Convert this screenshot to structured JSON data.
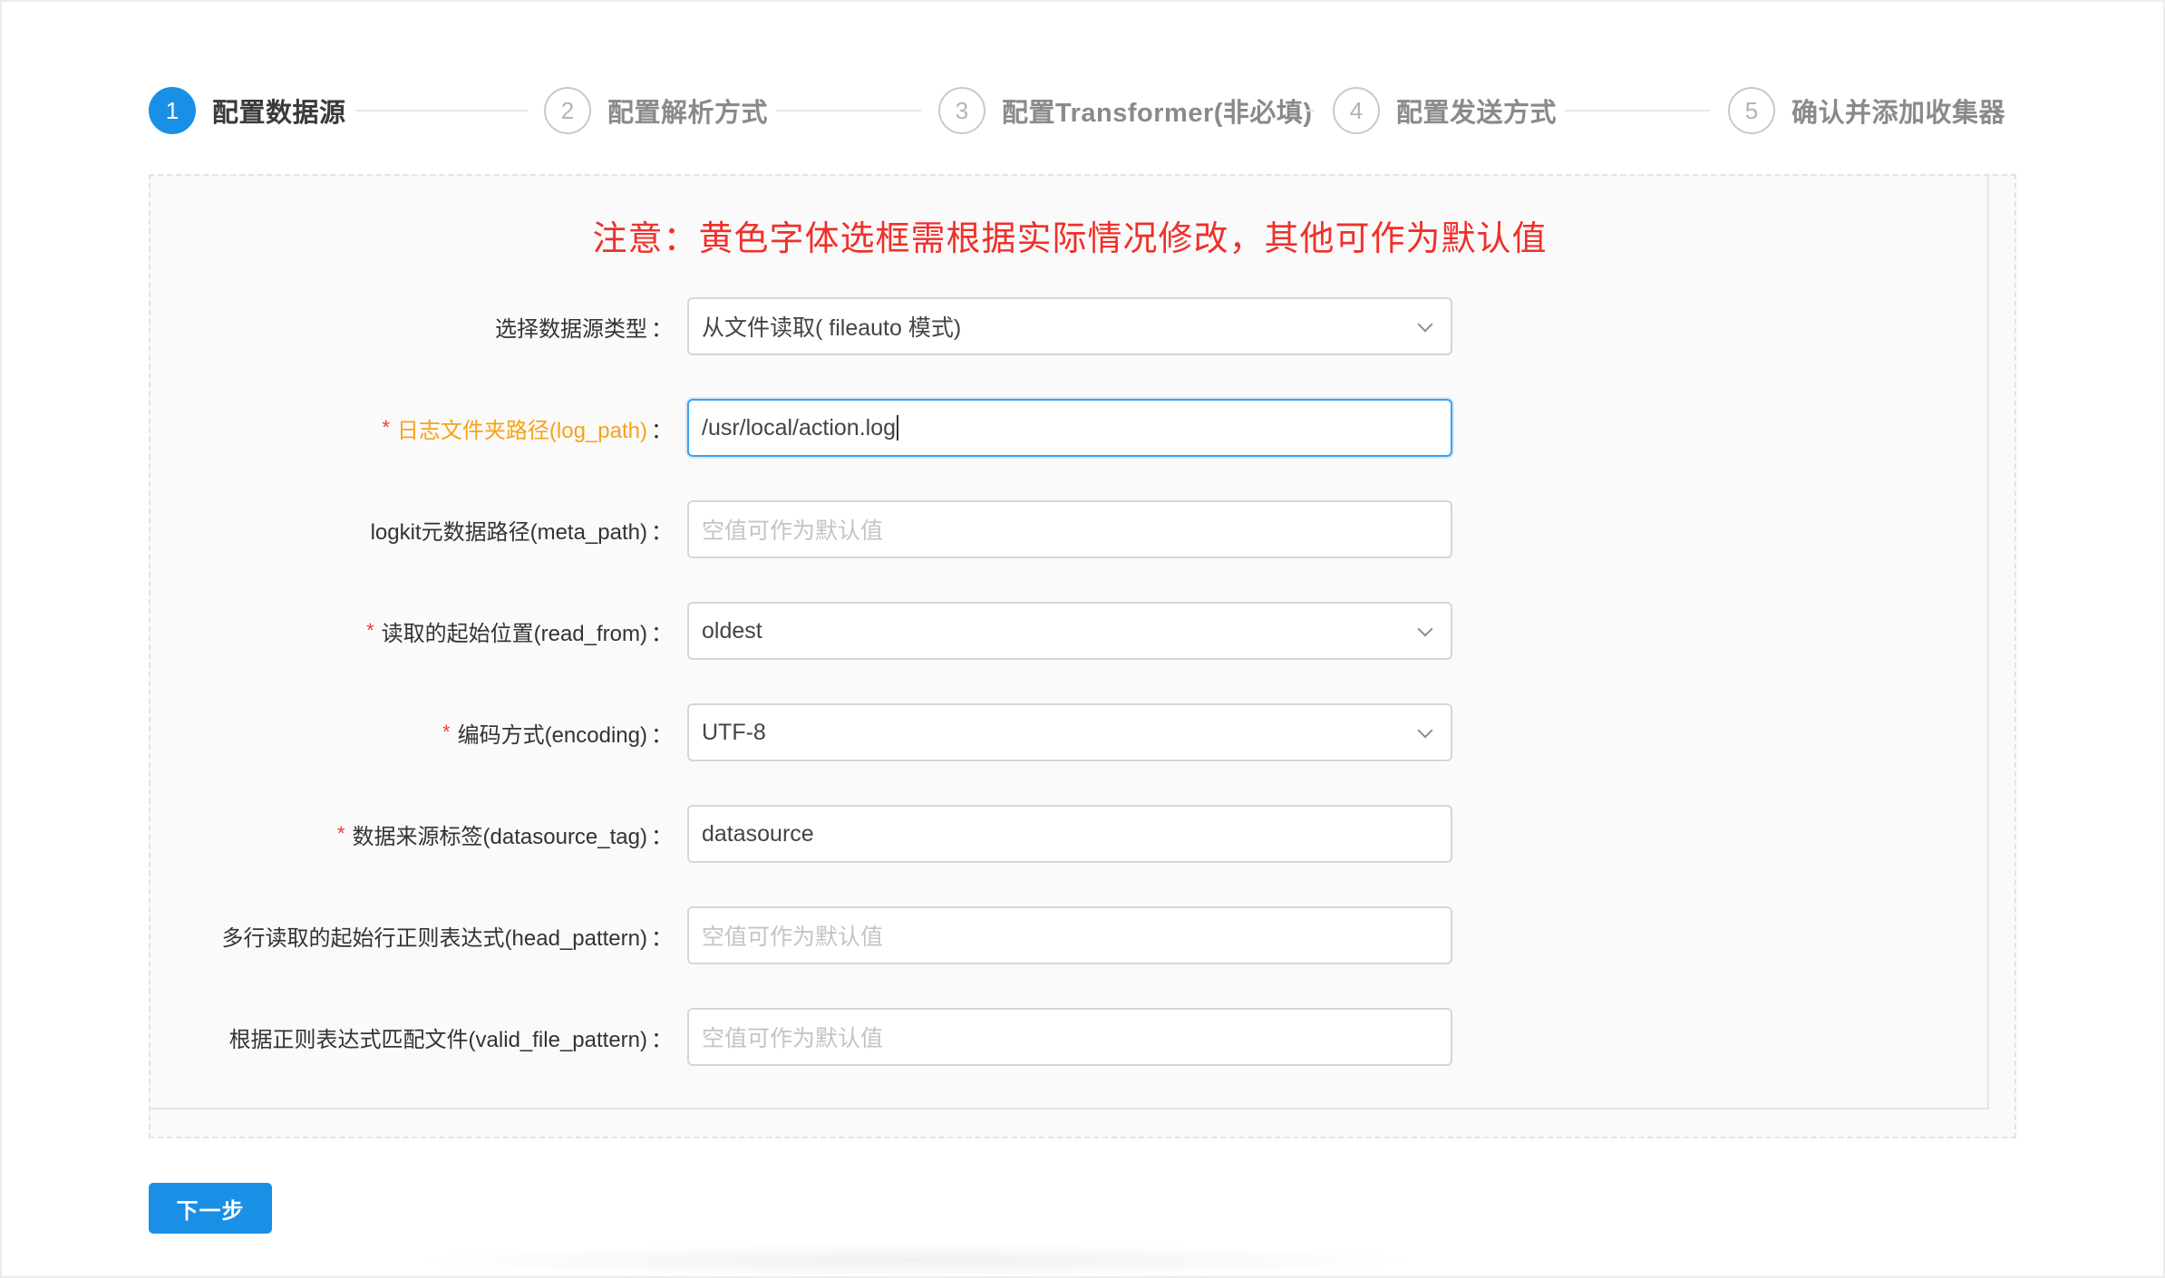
{
  "steps": [
    {
      "num": "1",
      "title": "配置数据源",
      "active": true
    },
    {
      "num": "2",
      "title": "配置解析方式",
      "active": false
    },
    {
      "num": "3",
      "title": "配置Transformer(非必填)",
      "active": false
    },
    {
      "num": "4",
      "title": "配置发送方式",
      "active": false
    },
    {
      "num": "5",
      "title": "确认并添加收集器",
      "active": false
    }
  ],
  "notice": "注意：黄色字体选框需根据实际情况修改，其他可作为默认值",
  "form": {
    "source_type": {
      "label": "选择数据源类型",
      "value": "从文件读取( fileauto 模式)"
    },
    "log_path": {
      "label": "日志文件夹路径(log_path)",
      "value": "/usr/local/action.log",
      "required": true
    },
    "meta_path": {
      "label": "logkit元数据路径(meta_path)",
      "placeholder": "空值可作为默认值"
    },
    "read_from": {
      "label": "读取的起始位置(read_from)",
      "value": "oldest",
      "required": true
    },
    "encoding": {
      "label": "编码方式(encoding)",
      "value": "UTF-8",
      "required": true
    },
    "datasource_tag": {
      "label": "数据来源标签(datasource_tag)",
      "value": "datasource",
      "required": true
    },
    "head_pattern": {
      "label": "多行读取的起始行正则表达式(head_pattern)",
      "placeholder": "空值可作为默认值"
    },
    "valid_file_pattern": {
      "label": "根据正则表达式匹配文件(valid_file_pattern)",
      "placeholder": "空值可作为默认值"
    }
  },
  "colon": "：",
  "required_mark": "*",
  "next_button": "下一步",
  "colors": {
    "primary": "#1a8fe6",
    "notice": "#f0302a",
    "warn_label": "#f7a21a",
    "required": "#f04134"
  },
  "icons": {
    "dropdown": "chevron-down-icon"
  }
}
